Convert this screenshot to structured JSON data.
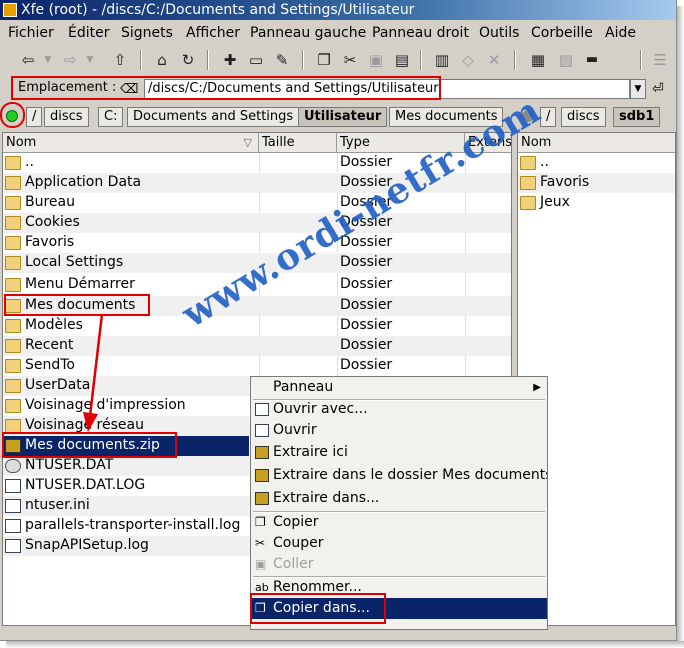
{
  "window": {
    "title": "Xfe (root) - /discs/C:/Documents and Settings/Utilisateur"
  },
  "menu": [
    "Fichier",
    "Éditer",
    "Signets",
    "Afficher",
    "Panneau gauche",
    "Panneau droit",
    "Outils",
    "Corbeille",
    "Aide"
  ],
  "location": {
    "label": "Emplacement :",
    "path": "/discs/C:/Documents and Settings/Utilisateur"
  },
  "left_panel": {
    "breadcrumb": [
      "/",
      "discs",
      "C:",
      "Documents and Settings",
      "Utilisateur",
      "Mes documents"
    ],
    "active_crumb": "Utilisateur",
    "columns": [
      "Nom",
      "Taille",
      "Type",
      "Extens"
    ],
    "rows": [
      {
        "name": "..",
        "type": "Dossier",
        "icon": "parent-folder-icon"
      },
      {
        "name": "Application Data",
        "type": "Dossier",
        "icon": "folder-icon"
      },
      {
        "name": "Bureau",
        "type": "Dossier",
        "icon": "folder-icon"
      },
      {
        "name": "Cookies",
        "type": "Dossier",
        "icon": "folder-icon"
      },
      {
        "name": "Favoris",
        "type": "Dossier",
        "icon": "folder-icon"
      },
      {
        "name": "Local Settings",
        "type": "Dossier",
        "icon": "folder-icon"
      },
      {
        "name": "Menu Démarrer",
        "type": "Dossier",
        "icon": "folder-icon"
      },
      {
        "name": "Mes documents",
        "type": "Dossier",
        "icon": "folder-icon"
      },
      {
        "name": "Modèles",
        "type": "Dossier",
        "icon": "folder-icon"
      },
      {
        "name": "Recent",
        "type": "Dossier",
        "icon": "folder-icon"
      },
      {
        "name": "SendTo",
        "type": "Dossier",
        "icon": "folder-icon"
      },
      {
        "name": "UserData",
        "type": "",
        "icon": "folder-icon"
      },
      {
        "name": "Voisinage d'impression",
        "type": "",
        "icon": "folder-icon"
      },
      {
        "name": "Voisinage réseau",
        "type": "",
        "icon": "folder-icon"
      },
      {
        "name": "Mes documents.zip",
        "type": "",
        "icon": "zip-file-icon",
        "selected": true
      },
      {
        "name": "NTUSER.DAT",
        "type": "",
        "icon": "system-file-icon"
      },
      {
        "name": "NTUSER.DAT.LOG",
        "type": "",
        "icon": "text-file-icon"
      },
      {
        "name": "ntuser.ini",
        "type": "",
        "icon": "text-file-icon"
      },
      {
        "name": "parallels-transporter-install.log",
        "type": "",
        "icon": "text-file-icon"
      },
      {
        "name": "SnapAPISetup.log",
        "type": "",
        "icon": "text-file-icon"
      }
    ]
  },
  "right_panel": {
    "breadcrumb": [
      "/",
      "discs",
      "sdb1"
    ],
    "active_crumb": "sdb1",
    "columns": [
      "Nom"
    ],
    "rows": [
      {
        "name": "..",
        "icon": "parent-folder-icon"
      },
      {
        "name": "Favoris",
        "icon": "folder-icon"
      },
      {
        "name": "Jeux",
        "icon": "folder-icon"
      }
    ]
  },
  "context_menu": {
    "items": [
      {
        "label": "Panneau",
        "submenu": true
      },
      {
        "label": "Ouvrir avec..."
      },
      {
        "label": "Ouvrir"
      },
      {
        "label": "Extraire ici"
      },
      {
        "label": "Extraire dans le dossier Mes documents"
      },
      {
        "label": "Extraire dans..."
      },
      {
        "label": "Copier"
      },
      {
        "label": "Couper"
      },
      {
        "label": "Coller",
        "disabled": true
      },
      {
        "label": "Renommer..."
      },
      {
        "label": "Copier dans...",
        "highlighted": true
      }
    ]
  },
  "watermark": "www.ordi-netfr.com",
  "colors": {
    "selection": "#0a246a",
    "highlight_box": "#e00000",
    "watermark": "#1f5fc4",
    "status_led": "#22cc22"
  }
}
